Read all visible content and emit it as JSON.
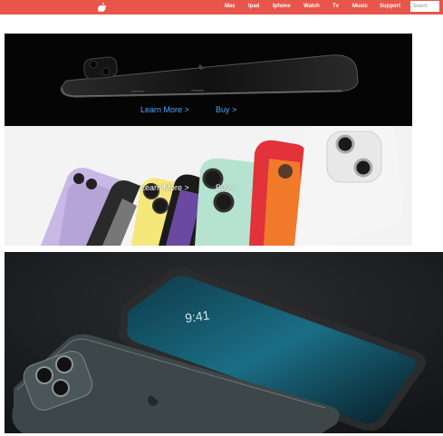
{
  "nav": {
    "background": "#e8554a",
    "logo_icon": "apple-logo-icon",
    "items": [
      {
        "label": "Mac"
      },
      {
        "label": "Ipad"
      },
      {
        "label": "Iphone"
      },
      {
        "label": "Watch"
      },
      {
        "label": "Tv"
      },
      {
        "label": "Music"
      },
      {
        "label": "Support"
      }
    ],
    "search": {
      "placeholder": "Search",
      "value": ""
    }
  },
  "hero1": {
    "learn_more": "Learn More >",
    "buy": "Buy >"
  },
  "hero2": {
    "learn_more": "Learn More >",
    "buy": "Buy >"
  },
  "link_color": "#4fa3ff"
}
